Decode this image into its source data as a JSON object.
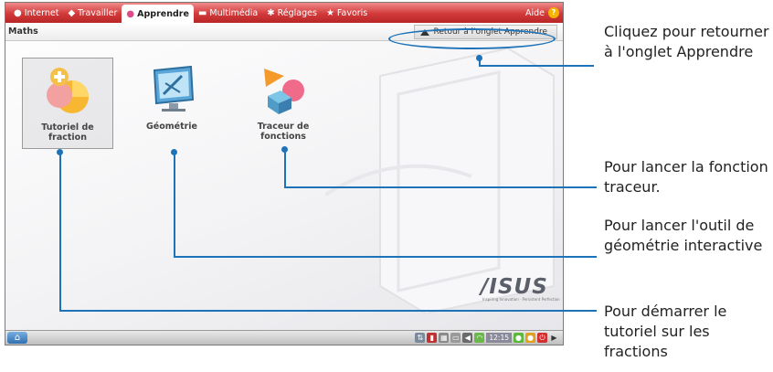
{
  "tabs": [
    {
      "label": "Internet",
      "icon": "globe-icon"
    },
    {
      "label": "Travailler",
      "icon": "work-icon"
    },
    {
      "label": "Apprendre",
      "icon": "learn-icon",
      "active": true
    },
    {
      "label": "Multimédia",
      "icon": "media-icon"
    },
    {
      "label": "Réglages",
      "icon": "settings-icon"
    },
    {
      "label": "Favoris",
      "icon": "star-icon"
    }
  ],
  "help_label": "Aide",
  "section_title": "Maths",
  "back_button_label": "Retour à l'onglet Apprendre",
  "apps": [
    {
      "label": "Tutoriel de fraction",
      "icon": "fraction-tutorial-icon"
    },
    {
      "label": "Géométrie",
      "icon": "geometry-icon"
    },
    {
      "label": "Traceur de fonctions",
      "icon": "function-plotter-icon"
    }
  ],
  "brand_logo": "/ISUS",
  "brand_tagline": "Inspiring Innovation · Persistent Perfection",
  "clock": "12:15",
  "callouts": {
    "back": "Cliquez pour retourner à l'onglet Apprendre",
    "plotter": "Pour lancer la fonction traceur.",
    "geometry": "Pour lancer l'outil de géométrie interactive",
    "fraction": "Pour démarrer le tutoriel sur les fractions"
  },
  "colors": {
    "tab_bar": "#d23a3a",
    "callout_line": "#1e73b8"
  }
}
